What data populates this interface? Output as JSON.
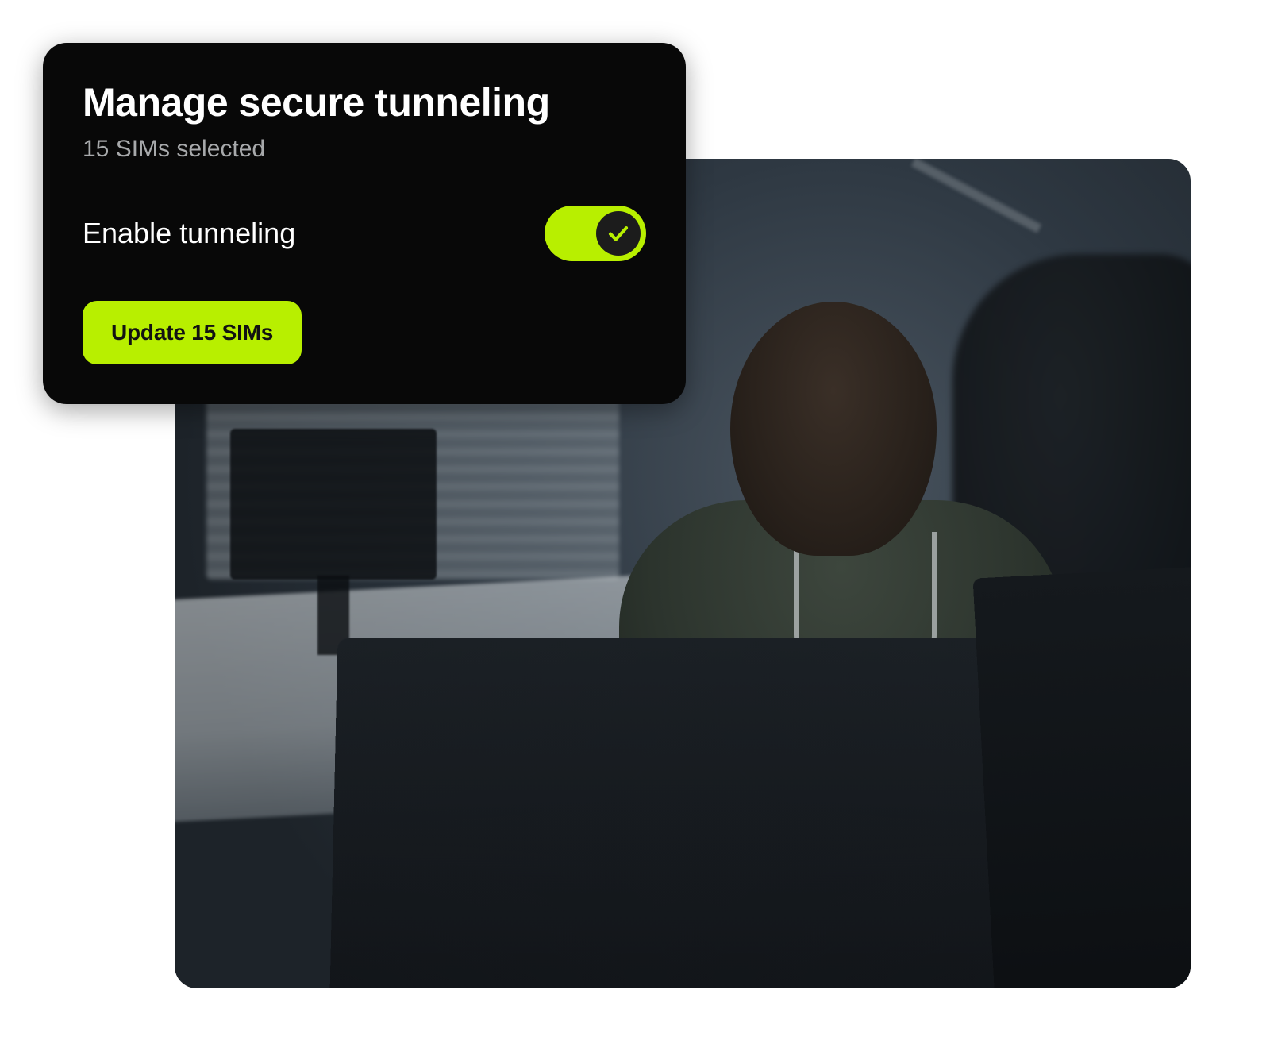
{
  "colors": {
    "accent": "#b8ef00",
    "card_bg": "#080808",
    "text_primary": "#ffffff",
    "text_secondary": "#a7a9ab",
    "button_text": "#121212"
  },
  "dialog": {
    "title": "Manage secure tunneling",
    "subtitle": "15 SIMs selected",
    "setting": {
      "label": "Enable tunneling",
      "enabled": true,
      "icon": "check-icon"
    },
    "primary_button": {
      "label": "Update 15 SIMs"
    }
  },
  "background": {
    "description": "office-photo"
  }
}
